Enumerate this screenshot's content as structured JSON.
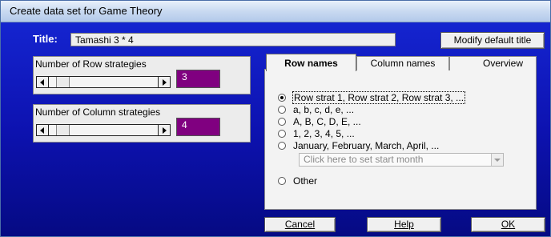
{
  "window": {
    "title": "Create data set for Game Theory"
  },
  "title_field": {
    "label": "Title:",
    "value": "Tamashi 3 * 4"
  },
  "buttons": {
    "modify_default_title": "Modify default title",
    "cancel": "Cancel",
    "help": "Help",
    "ok": "OK"
  },
  "row_strategies": {
    "label": "Number of Row strategies",
    "value": "3"
  },
  "column_strategies": {
    "label": "Number of Column strategies",
    "value": "4"
  },
  "tabs": [
    {
      "label": "Row names",
      "active": true
    },
    {
      "label": "Column names",
      "active": false
    },
    {
      "label": "Overview",
      "active": false
    }
  ],
  "naming_options": [
    {
      "label": "Row strat 1, Row strat 2, Row strat 3, ...",
      "selected": true
    },
    {
      "label": "a, b, c, d, e, ...",
      "selected": false
    },
    {
      "label": "A, B, C, D, E, ...",
      "selected": false
    },
    {
      "label": "1, 2, 3, 4, 5, ...",
      "selected": false
    },
    {
      "label": "January, February, March, April, ...",
      "selected": false
    },
    {
      "label": "Other",
      "selected": false
    }
  ],
  "month_combo": {
    "placeholder": "Click here to set start month"
  },
  "colors": {
    "value_box": "#800080",
    "background_top": "#1628d6",
    "background_bottom": "#050a83"
  },
  "icons": {
    "scroll_left": "arrow-left-icon",
    "scroll_right": "arrow-right-icon",
    "dropdown": "chevron-down-icon"
  }
}
